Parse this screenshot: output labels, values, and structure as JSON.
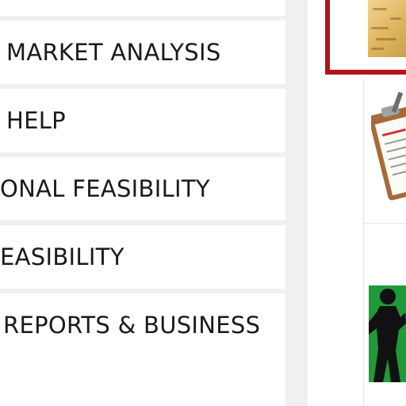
{
  "menu": {
    "items": [
      {
        "label": "MARKET ANALYSIS"
      },
      {
        "label": "HELP"
      },
      {
        "label": "ONAL FEASIBILITY"
      },
      {
        "label": "EASIBILITY"
      },
      {
        "label": "REPORTS & BUSINESS"
      }
    ]
  },
  "thumbnails": {
    "items": [
      {
        "icon": "document-paper-icon",
        "selected": true
      },
      {
        "icon": "clipboard-icon",
        "selected": false
      },
      {
        "icon": "silhouette-figure-icon",
        "selected": false
      }
    ]
  },
  "colors": {
    "highlight": "#b31217",
    "menu_background": "#ffffff",
    "column_background": "#f0f0f0",
    "thumbnail_green": "#1f9a3a"
  }
}
